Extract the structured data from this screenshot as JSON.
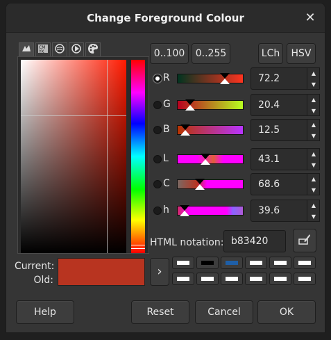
{
  "window": {
    "title": "Change Foreground Colour",
    "close_glyph": "✕"
  },
  "selector_tabs": [
    {
      "icon": "wilber-icon",
      "glyph": "🐾"
    },
    {
      "icon": "cmyk-icon",
      "glyph": "CMYK"
    },
    {
      "icon": "watercolor-icon",
      "glyph": "≋"
    },
    {
      "icon": "triangle-icon",
      "glyph": "▷"
    },
    {
      "icon": "palette-icon",
      "glyph": "🎨"
    }
  ],
  "range_buttons": {
    "btn_0_100": "0..100",
    "btn_0_255": "0..255"
  },
  "mode_buttons": {
    "lch": "LCh",
    "hsv": "HSV"
  },
  "channels": [
    {
      "label": "R",
      "value": "72.2",
      "selected": true,
      "marker": 0.72,
      "gradient": "linear-gradient(to right, #003420, #ff3420)"
    },
    {
      "label": "G",
      "value": "20.4",
      "selected": false,
      "marker": 0.2,
      "gradient": "linear-gradient(to right, #b80020, #b8ff20)"
    },
    {
      "label": "B",
      "value": "12.5",
      "selected": false,
      "marker": 0.125,
      "gradient": "linear-gradient(to right, #b83400, #b834ff)"
    },
    {
      "label": "L",
      "value": "43.1",
      "selected": false,
      "marker": 0.43,
      "gradient": "linear-gradient(to right, #ff00ff 0%, #ff00ff 30%, #e0603a 55%, #ff00ff 70%, #ff00ff 100%)"
    },
    {
      "label": "C",
      "value": "68.6",
      "selected": false,
      "marker": 0.34,
      "gradient": "linear-gradient(to right, #7a6862, #b83420 30%, #ff00ff 45%, #ff00ff 100%)"
    },
    {
      "label": "h",
      "value": "39.6",
      "selected": false,
      "marker": 0.11,
      "gradient": "linear-gradient(to right, #d02a6a, #ff00ff 20%, #ff00ff 75%, #8a64ff 85%, #b05ad8 100%)"
    }
  ],
  "spin": {
    "up": "▲",
    "down": "▼"
  },
  "html_notation": {
    "label": "HTML notation:",
    "value": "b83420"
  },
  "swatch": {
    "current_label": "Current:",
    "old_label": "Old:",
    "color": "#b83420"
  },
  "history": {
    "arrow": "›",
    "colors": [
      "#ffffff",
      "#000000",
      "#1e5fa8",
      "#ffffff",
      "#ffffff",
      "#ffffff",
      "#ffffff",
      "#ffffff",
      "#ffffff",
      "#ffffff",
      "#ffffff",
      "#ffffff"
    ]
  },
  "footer": {
    "help": "Help",
    "reset": "Reset",
    "cancel": "Cancel",
    "ok": "OK"
  }
}
